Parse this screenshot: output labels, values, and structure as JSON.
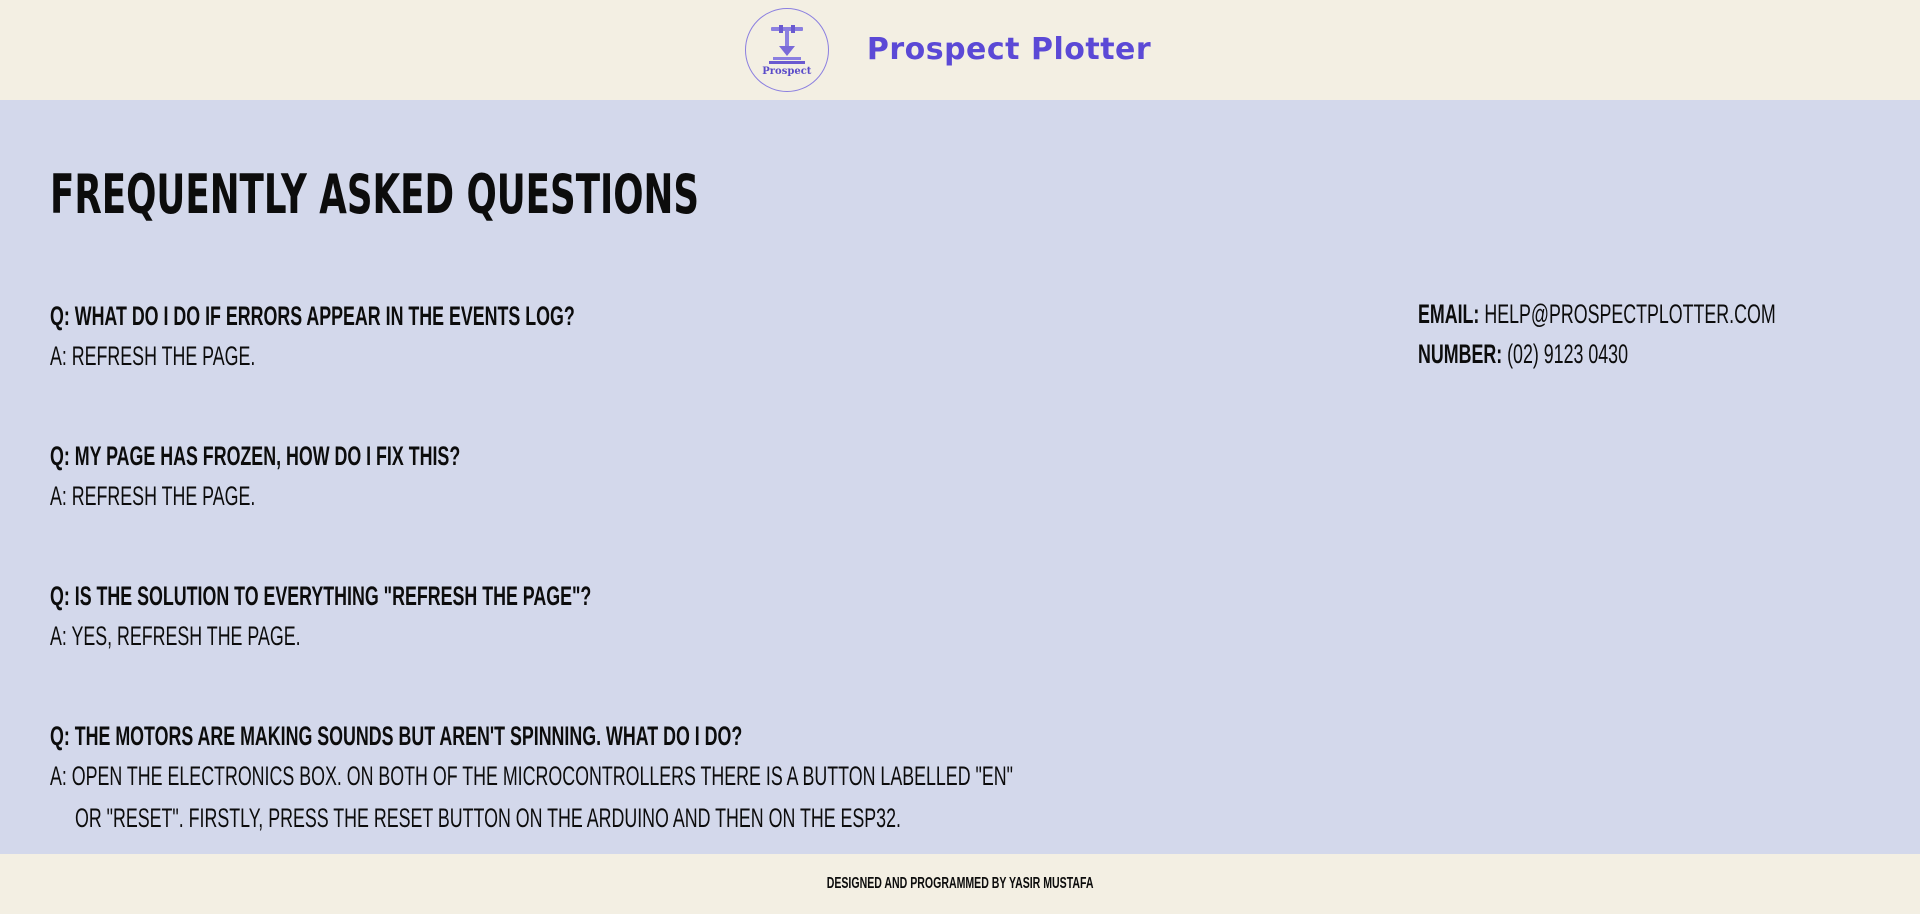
{
  "header": {
    "logo_text": "Prospect",
    "brand": "Prospect Plotter"
  },
  "main": {
    "title": "Frequently Asked Questions",
    "faq": [
      {
        "q": "Q: What do I do if errors appear in the events log?",
        "a": "A: Refresh the page."
      },
      {
        "q": "Q: My page has frozen, how do I fix this?",
        "a": "A: Refresh the page."
      },
      {
        "q": "Q: Is the solution to everything \"refresh the page\"?",
        "a": "A: Yes, refresh the page."
      },
      {
        "q": "Q: The motors are making sounds but aren't spinning. What do I do?",
        "a": "A: Open the electronics box. On both of the microcontrollers there is a button labelled \"EN\"",
        "a_cont": "or \"reset\". Firstly, press the reset button on the arduino and then on the ESP32."
      }
    ],
    "contact": {
      "email_label": "Email:",
      "email": "help@prospectplotter.com",
      "number_label": "Number:",
      "number": "(02) 9123 0430"
    }
  },
  "footer": {
    "credit": "Designed and programmed by Yasir Mustafa"
  },
  "colors": {
    "header_bg": "#f3efe3",
    "main_bg": "#d3d8eb",
    "brand": "#5b49d6"
  }
}
